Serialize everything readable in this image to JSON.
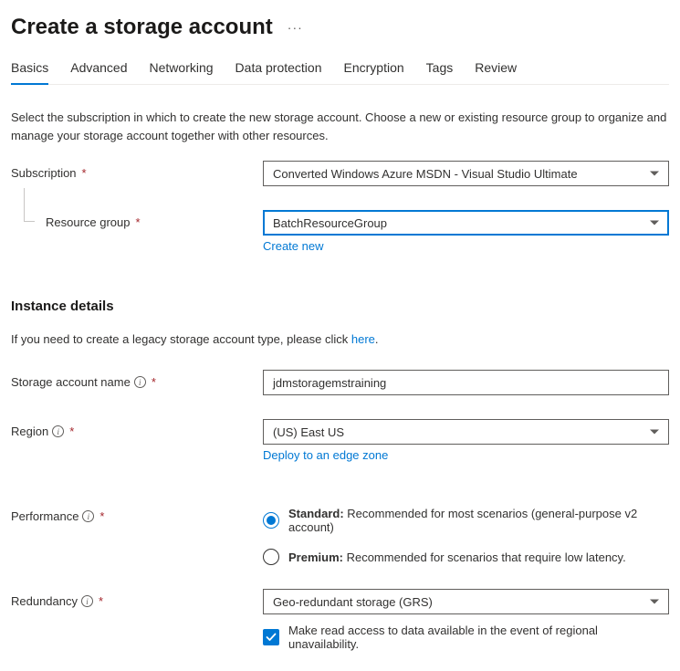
{
  "header": {
    "title": "Create a storage account",
    "more": "···"
  },
  "tabs": [
    {
      "label": "Basics",
      "active": true
    },
    {
      "label": "Advanced",
      "active": false
    },
    {
      "label": "Networking",
      "active": false
    },
    {
      "label": "Data protection",
      "active": false
    },
    {
      "label": "Encryption",
      "active": false
    },
    {
      "label": "Tags",
      "active": false
    },
    {
      "label": "Review",
      "active": false
    }
  ],
  "intro": "Select the subscription in which to create the new storage account. Choose a new or existing resource group to organize and manage your storage account together with other resources.",
  "subscription": {
    "label": "Subscription",
    "value": "Converted Windows Azure MSDN - Visual Studio Ultimate"
  },
  "resource_group": {
    "label": "Resource group",
    "value": "BatchResourceGroup",
    "create_new": "Create new"
  },
  "instance": {
    "heading": "Instance details",
    "legacy_prefix": "If you need to create a legacy storage account type, please click ",
    "legacy_link": "here",
    "legacy_suffix": "."
  },
  "storage_name": {
    "label": "Storage account name",
    "value": "jdmstoragemstraining"
  },
  "region": {
    "label": "Region",
    "value": "(US) East US",
    "edge_link": "Deploy to an edge zone"
  },
  "performance": {
    "label": "Performance",
    "options": [
      {
        "strong": "Standard:",
        "text": " Recommended for most scenarios (general-purpose v2 account)",
        "checked": true
      },
      {
        "strong": "Premium:",
        "text": " Recommended for scenarios that require low latency.",
        "checked": false
      }
    ]
  },
  "redundancy": {
    "label": "Redundancy",
    "value": "Geo-redundant storage (GRS)",
    "checkbox_label": "Make read access to data available in the event of regional unavailability.",
    "checkbox_checked": true
  }
}
